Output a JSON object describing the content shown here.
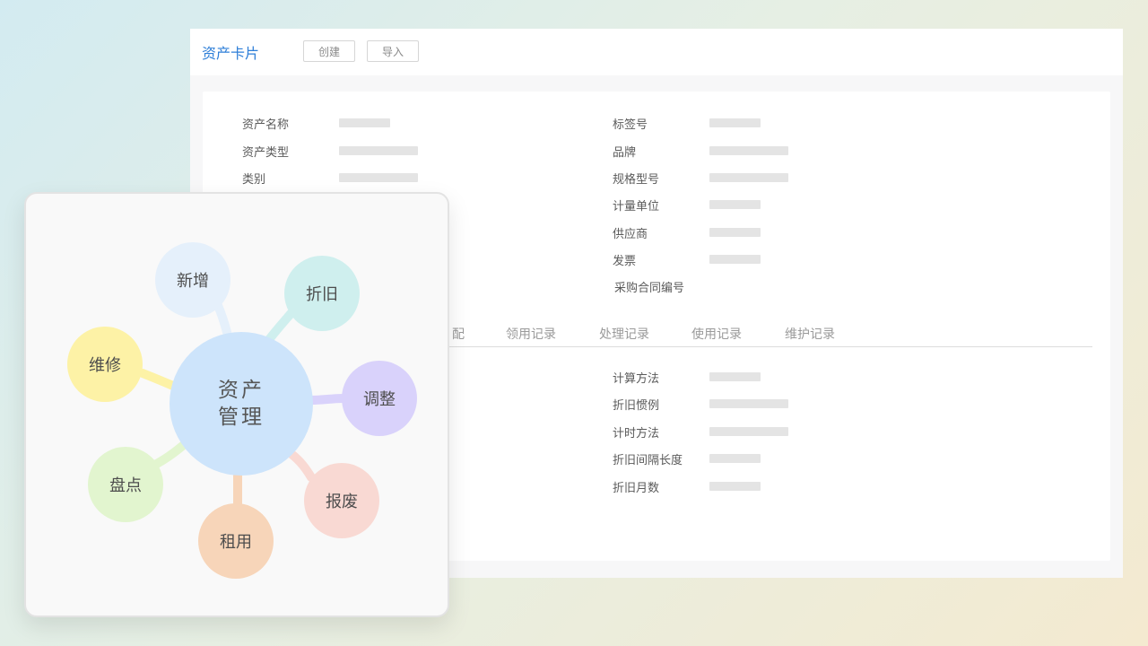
{
  "window": {
    "title": "资产卡片",
    "buttons": {
      "create": "创建",
      "import": "导入"
    }
  },
  "info_left": {
    "asset_name": "资产名称",
    "asset_type": "资产类型",
    "category": "类别"
  },
  "info_right": {
    "tag_no": "标签号",
    "brand": "品牌",
    "spec_model": "规格型号",
    "unit": "计量单位",
    "supplier": "供应商",
    "invoice": "发票",
    "purchase_contract_no": "采购合同编号"
  },
  "tabs": {
    "partial": "配",
    "receive": "领用记录",
    "process": "处理记录",
    "usage": "使用记录",
    "maintain": "维护记录"
  },
  "depreciation": {
    "calc_method": "计算方法",
    "convention": "折旧惯例",
    "timing_method": "计时方法",
    "interval_length": "折旧间隔长度",
    "months": "折旧月数"
  },
  "mindmap": {
    "center_line1": "资产",
    "center_line2": "管理",
    "nodes": {
      "add": "新增",
      "depreciate": "折旧",
      "repair": "维修",
      "adjust": "调整",
      "inventory": "盘点",
      "scrap": "报废",
      "lease": "租用"
    },
    "colors": {
      "center": "#cde4fb",
      "add": "#e5f0fb",
      "depreciate": "#cfefee",
      "repair": "#fdf2a6",
      "adjust": "#d9d2fb",
      "inventory": "#e2f5cf",
      "scrap": "#f9d9d3",
      "lease": "#f7d5b9"
    }
  }
}
